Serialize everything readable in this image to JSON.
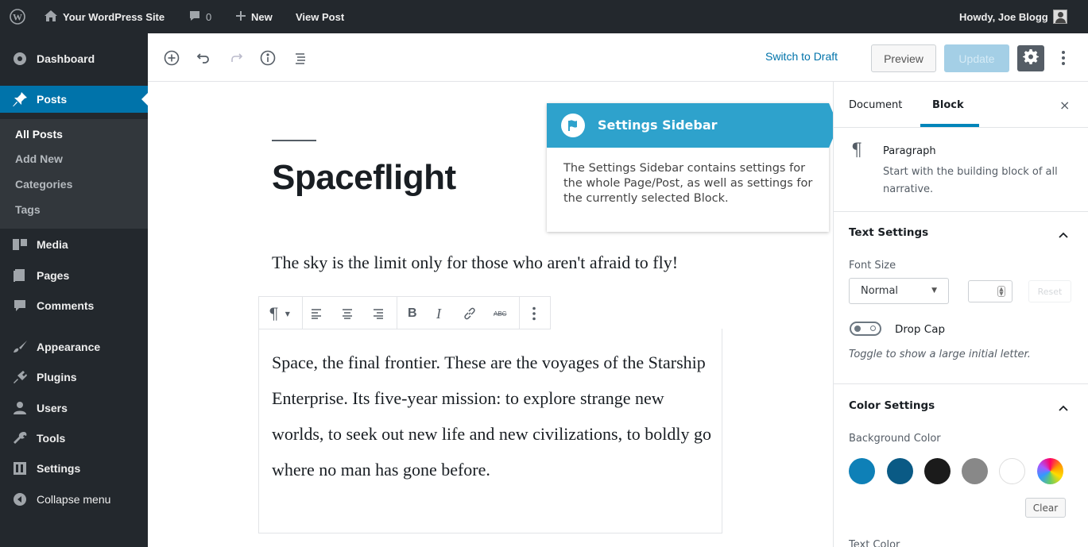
{
  "admin_bar": {
    "site_name": "Your WordPress Site",
    "comments_count": "0",
    "new_label": "New",
    "view_post_label": "View Post",
    "greeting": "Howdy, Joe Blogg"
  },
  "sidebar": {
    "items": [
      {
        "label": "Dashboard",
        "icon": "dashboard-icon"
      },
      {
        "label": "Posts",
        "icon": "pin-icon"
      },
      {
        "label": "Media",
        "icon": "media-icon"
      },
      {
        "label": "Pages",
        "icon": "pages-icon"
      },
      {
        "label": "Comments",
        "icon": "comments-icon"
      },
      {
        "label": "Appearance",
        "icon": "brush-icon"
      },
      {
        "label": "Plugins",
        "icon": "plugin-icon"
      },
      {
        "label": "Users",
        "icon": "users-icon"
      },
      {
        "label": "Tools",
        "icon": "wrench-icon"
      },
      {
        "label": "Settings",
        "icon": "settings-icon"
      }
    ],
    "posts_submenu": [
      "All Posts",
      "Add New",
      "Categories",
      "Tags"
    ],
    "collapse_label": "Collapse menu"
  },
  "toolbar": {
    "switch_to_draft": "Switch to Draft",
    "preview": "Preview",
    "update": "Update"
  },
  "editor": {
    "title": "Spaceflight",
    "paragraph1": "The sky is the limit only for those who aren't afraid to fly!",
    "paragraph2": "Space, the final frontier. These are the voyages of the Starship Enterprise. Its five-year mission: to explore strange new worlds, to seek out new life and new civilizations, to boldly go where no man has gone before.",
    "block_toolbar": {
      "paragraph_symbol": "¶",
      "bold": "B",
      "italic": "I",
      "strikethrough": "ABC"
    }
  },
  "callout": {
    "title": "Settings Sidebar",
    "body": "The Settings Sidebar contains settings for the whole Page/Post, as well as settings for the currently selected Block."
  },
  "settings_sidebar": {
    "tabs": {
      "document": "Document",
      "block": "Block"
    },
    "close_symbol": "×",
    "block_card": {
      "name": "Paragraph",
      "description": "Start with the building block of all narrative."
    },
    "text_settings": {
      "title": "Text Settings",
      "font_size_label": "Font Size",
      "font_size_value": "Normal",
      "reset": "Reset",
      "drop_cap_label": "Drop Cap",
      "drop_cap_help": "Toggle to show a large initial letter."
    },
    "color_settings": {
      "title": "Color Settings",
      "background_label": "Background Color",
      "swatches": [
        "#0e80b7",
        "#0a5a85",
        "#1b1b1b",
        "#888888",
        "#ffffff",
        "gradient"
      ],
      "clear": "Clear",
      "text_color_label": "Text Color"
    }
  },
  "colors": {
    "admin_dark": "#23282d",
    "accent_blue": "#0073aa",
    "callout_blue": "#2ea2cc"
  }
}
